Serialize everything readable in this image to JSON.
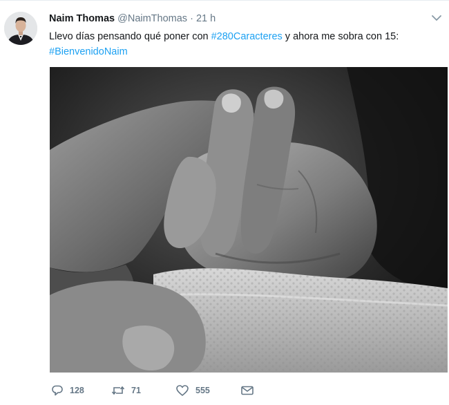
{
  "tweet": {
    "display_name": "Naim Thomas",
    "handle": "@NaimThomas",
    "separator": "·",
    "time": "21 h",
    "text_part1": "Llevo días pensando qué poner con ",
    "hashtag1": "#280Caracteres",
    "text_part2": " y ahora me sobra con 15:",
    "hashtag2": "#BienvenidoNaim",
    "media_icon": "baby-hand-photo",
    "more_icon": "chevron-down-icon"
  },
  "actions": {
    "reply": {
      "icon": "reply-icon",
      "count": "128"
    },
    "retweet": {
      "icon": "retweet-icon",
      "count": "71"
    },
    "like": {
      "icon": "heart-icon",
      "count": "555"
    },
    "dm": {
      "icon": "envelope-icon"
    }
  },
  "colors": {
    "link": "#1da1f2",
    "secondary": "#657786",
    "text": "#14171a"
  }
}
